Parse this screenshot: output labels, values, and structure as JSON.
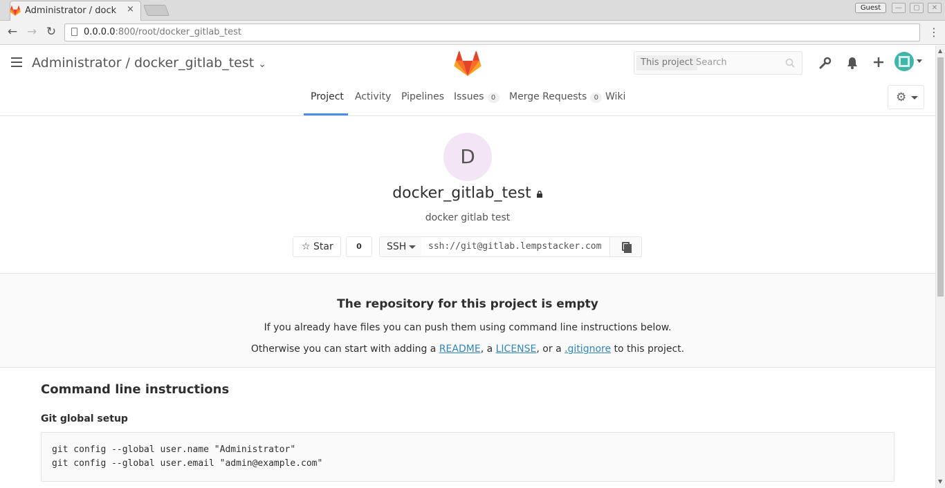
{
  "browser": {
    "tab_title": "Administrator / dock",
    "tab_close": "×",
    "guest_label": "Guest",
    "url_host": "0.0.0.0",
    "url_rest": ":800/root/docker_gitlab_test",
    "back": "←",
    "forward": "→",
    "reload": "↻",
    "menu": "⋮",
    "win_min": "—",
    "win_max": "▢",
    "win_close": "✕"
  },
  "header": {
    "breadcrumb": "Administrator / docker_gitlab_test",
    "breadcrumb_caret": "⌄",
    "search_scope": "This project",
    "search_placeholder": "Search",
    "icons": [
      "wrench-icon",
      "bell-icon",
      "plus-icon",
      "avatar"
    ]
  },
  "subnav": {
    "items": [
      {
        "label": "Project",
        "count": null
      },
      {
        "label": "Activity",
        "count": null
      },
      {
        "label": "Pipelines",
        "count": null
      },
      {
        "label": "Issues",
        "count": "0"
      },
      {
        "label": "Merge Requests",
        "count": "0"
      },
      {
        "label": "Wiki",
        "count": null
      }
    ]
  },
  "project": {
    "avatar_letter": "D",
    "name": "docker_gitlab_test",
    "description": "docker gitlab test",
    "star_label": "Star",
    "star_count": "0",
    "clone_protocol": "SSH",
    "clone_url": "ssh://git@gitlab.lempstacker.com"
  },
  "empty_state": {
    "title": "The repository for this project is empty",
    "line1": "If you already have files you can push them using command line instructions below.",
    "line2_prefix": "Otherwise you can start with adding a ",
    "readme_link": "README",
    "sep1": ", a ",
    "license_link": "LICENSE",
    "sep2": ", or a ",
    "gitignore_link": ".gitignore",
    "line2_suffix": " to this project."
  },
  "instructions": {
    "title": "Command line instructions",
    "git_global_title": "Git global setup",
    "git_global_code": "git config --global user.name \"Administrator\"\ngit config --global user.email \"admin@example.com\""
  },
  "colors": {
    "accent": "#4a8bee",
    "link": "#3084bb",
    "avatar_bg": "#f3e5f5"
  }
}
